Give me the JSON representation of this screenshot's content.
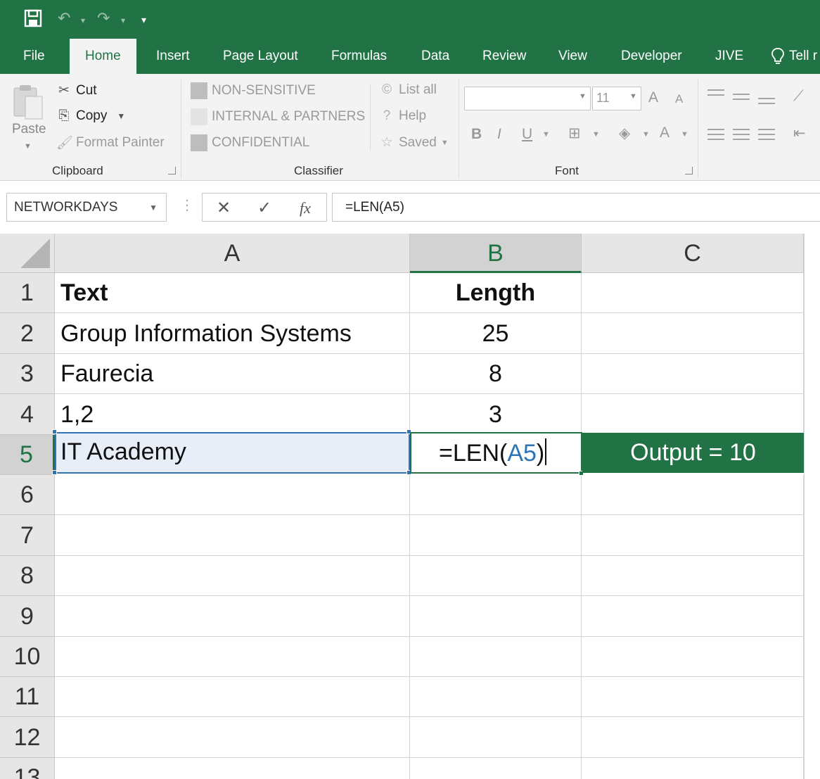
{
  "qat": {
    "save": "save-icon",
    "undo": "↶",
    "redo": "↷",
    "dropdown": "▾",
    "customize": "▾"
  },
  "tabs": [
    {
      "label": "File"
    },
    {
      "label": "Home"
    },
    {
      "label": "Insert"
    },
    {
      "label": "Page Layout"
    },
    {
      "label": "Formulas"
    },
    {
      "label": "Data"
    },
    {
      "label": "Review"
    },
    {
      "label": "View"
    },
    {
      "label": "Developer"
    },
    {
      "label": "JIVE"
    },
    {
      "label": "Tell r"
    }
  ],
  "ribbon": {
    "clipboard": {
      "paste": "Paste",
      "cut": "Cut",
      "copy": "Copy",
      "format_painter": "Format Painter",
      "label": "Clipboard"
    },
    "classifier": {
      "non_sensitive": "NON-SENSITIVE",
      "internal": "INTERNAL & PARTNERS",
      "confidential": "CONFIDENTIAL",
      "list_all": "List all",
      "help": "Help",
      "saved": "Saved",
      "label": "Classifier"
    },
    "font": {
      "size": "11",
      "bold": "B",
      "italic": "I",
      "underline": "U",
      "grow": "A",
      "shrink": "A",
      "font_color": "A",
      "label": "Font"
    }
  },
  "formula_bar": {
    "name_box": "NETWORKDAYS",
    "cancel": "✕",
    "enter": "✓",
    "fx": "fx",
    "formula": "=LEN(A5)"
  },
  "sheet": {
    "columns": [
      "A",
      "B",
      "C"
    ],
    "rows": [
      "1",
      "2",
      "3",
      "4",
      "5",
      "6",
      "7",
      "8",
      "9",
      "10",
      "11",
      "12",
      "13"
    ],
    "cells": {
      "A1": "Text",
      "B1": "Length",
      "A2": "Group Information Systems",
      "B2": "25",
      "A3": "Faurecia",
      "B3": "8",
      "A4": "1,2",
      "B4": "3",
      "A5": "IT Academy",
      "B5_prefix": "=LEN(",
      "B5_ref": "A5",
      "B5_suffix": ")",
      "C5": "Output = 10"
    },
    "colors": {
      "accent": "#217346",
      "reference": "#2e75b6"
    }
  }
}
